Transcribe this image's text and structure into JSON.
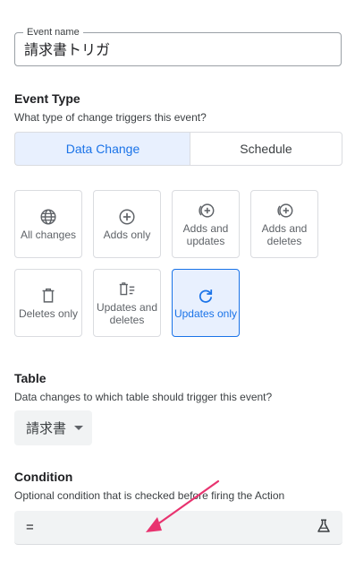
{
  "event_name": {
    "label": "Event name",
    "value": "請求書トリガ"
  },
  "event_type": {
    "title": "Event Type",
    "subtitle": "What type of change triggers this event?",
    "tabs": [
      {
        "label": "Data Change",
        "selected": true
      },
      {
        "label": "Schedule",
        "selected": false
      }
    ]
  },
  "options": [
    {
      "label": "All changes",
      "icon": "globe-icon",
      "selected": false
    },
    {
      "label": "Adds only",
      "icon": "add-circle-icon",
      "selected": false
    },
    {
      "label": "Adds and updates",
      "icon": "add-refresh-icon",
      "selected": false
    },
    {
      "label": "Adds and deletes",
      "icon": "add-delete-icon",
      "selected": false
    },
    {
      "label": "Deletes only",
      "icon": "trash-icon",
      "selected": false
    },
    {
      "label": "Updates and deletes",
      "icon": "trash-list-icon",
      "selected": false
    },
    {
      "label": "Updates only",
      "icon": "refresh-icon",
      "selected": true
    }
  ],
  "table": {
    "title": "Table",
    "subtitle": "Data changes to which table should trigger this event?",
    "selected": "請求書"
  },
  "condition": {
    "title": "Condition",
    "subtitle": "Optional condition that is checked before firing the Action",
    "value": "="
  },
  "colors": {
    "accent": "#1a73e8",
    "accent_bg": "#e8f0fe",
    "annotation_arrow": "#e8336f"
  }
}
